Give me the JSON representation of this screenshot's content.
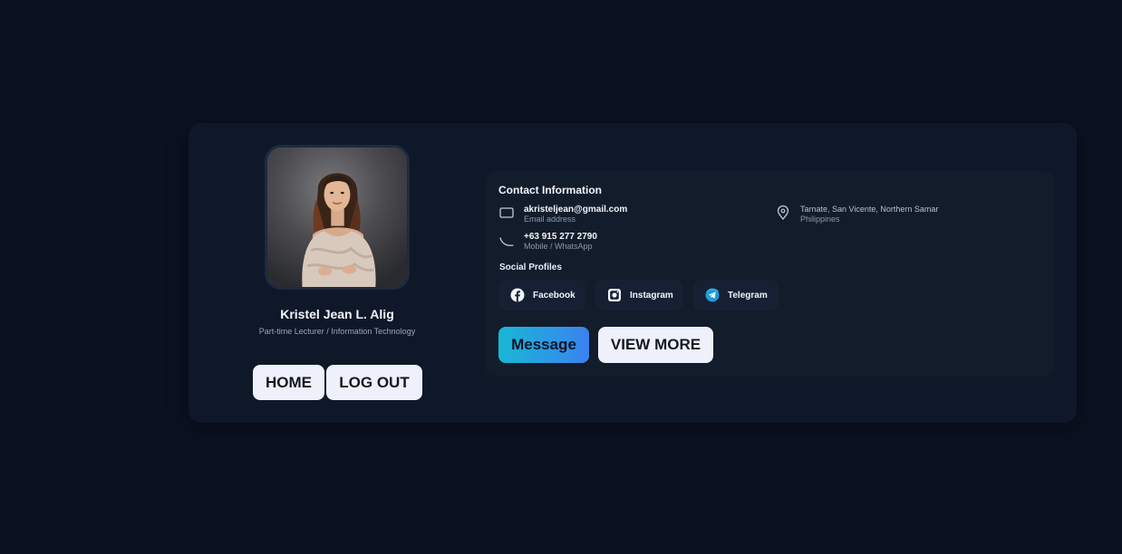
{
  "profile": {
    "name": "Kristel Jean L. Alig",
    "role": "Part-time Lecturer / Information Technology"
  },
  "nav": {
    "home_label": "HOME",
    "logout_label": "LOG OUT"
  },
  "contact": {
    "title": "Contact Information",
    "email": {
      "value": "akristeljean@gmail.com",
      "label": "Email address",
      "icon": "mail-icon"
    },
    "phone": {
      "value": "+63 915 277 2790",
      "label": "Mobile / WhatsApp",
      "icon": "phone-icon"
    },
    "location": {
      "value": "Tarnate, San Vicente, Northern Samar",
      "label": "Philippines",
      "icon": "map-pin-icon"
    }
  },
  "social": {
    "title": "Social Profiles",
    "items": [
      {
        "label": "Facebook",
        "icon": "facebook-icon"
      },
      {
        "label": "Instagram",
        "icon": "instagram-icon"
      },
      {
        "label": "Telegram",
        "icon": "telegram-icon"
      }
    ]
  },
  "actions": {
    "message_label": "Message",
    "view_more_label": "VIEW MORE"
  },
  "colors": {
    "background": "#0a1120",
    "card": "#0f1828",
    "panel": "#131c2b",
    "accent_gradient_start": "#19b7d6",
    "accent_gradient_end": "#3b82f0",
    "button_light": "#eef1fb"
  }
}
